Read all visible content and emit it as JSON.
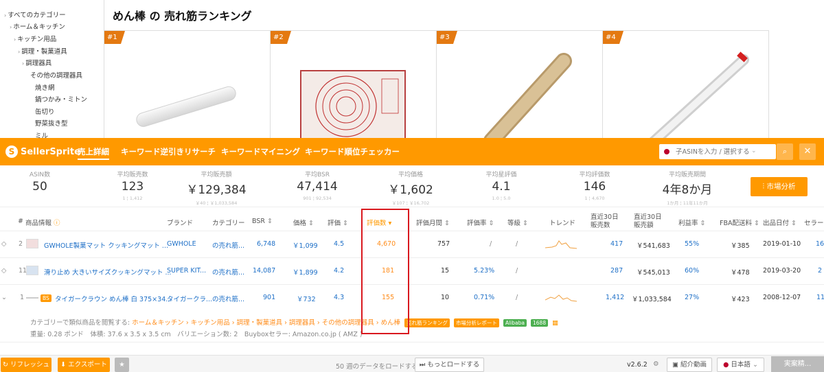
{
  "categories": [
    "すべてのカテゴリー",
    "ホーム＆キッチン",
    "キッチン用品",
    "調理・製菓道具",
    "調理器具",
    "その他の調理器具",
    "焼き網",
    "鍋つかみ・ミトン",
    "缶切り",
    "野菜抜き型",
    "ミル"
  ],
  "page_title": "めん棒 の 売れ筋ランキング",
  "ranks": [
    "#1",
    "#2",
    "#3",
    "#4"
  ],
  "brand": "SellerSprite",
  "nav": [
    "売上詳細",
    "キーワード逆引きリサーチ",
    "キーワードマイニング",
    "キーワード順位チェッカー"
  ],
  "search_placeholder": "子ASINを入力 / 選択する",
  "stats": [
    {
      "label": "ASIN数",
      "value": "50",
      "range": ""
    },
    {
      "label": "平均販売数",
      "value": "123",
      "range": "1 ¦ 1,412"
    },
    {
      "label": "平均販売額",
      "value": "￥129,384",
      "range": "￥40 ¦ ￥1,033,584"
    },
    {
      "label": "平均BSR",
      "value": "47,414",
      "range": "901 ¦ 92,534"
    },
    {
      "label": "平均価格",
      "value": "￥1,602",
      "range": "￥107 ¦ ￥16,702"
    },
    {
      "label": "平均星評価",
      "value": "4.1",
      "range": "1.0 ¦ 5.0"
    },
    {
      "label": "平均評価数",
      "value": "146",
      "range": "1 ¦ 4,670"
    },
    {
      "label": "平均販売期間",
      "value": "4年8か月",
      "range": "1か月 ¦ 11年11か月"
    }
  ],
  "market_btn": "市場分析",
  "headers": [
    "#",
    "商品情報",
    "ブランド",
    "カテゴリー",
    "BSR",
    "価格",
    "評価",
    "評価数",
    "評価月間",
    "評価率",
    "等級",
    "トレンド",
    "直近30日",
    "販売数",
    "直近30日",
    "販売額",
    "利益率",
    "FBA配送料",
    "出品日付",
    "セラー"
  ],
  "rows": [
    {
      "idx": "2",
      "title": "GWHOLE製菓マット クッキングマット ...",
      "brand": "GWHOLE",
      "cat": "の売れ筋...",
      "bsr": "6,748",
      "price": "￥1,099",
      "rating": "4.5",
      "reviews": "4,670",
      "monthly": "757",
      "rate": "/",
      "grade": "/",
      "sales": "417",
      "revenue": "￥541,683",
      "margin": "55%",
      "fba": "￥385",
      "date": "2019-01-10",
      "seller": "16"
    },
    {
      "idx": "11",
      "title": "滑り止め 大きいサイズクッキングマット ...",
      "brand": "SUPER KIT...",
      "cat": "の売れ筋...",
      "bsr": "14,087",
      "price": "￥1,899",
      "rating": "4.2",
      "reviews": "181",
      "monthly": "15",
      "rate": "5.23%",
      "grade": "/",
      "sales": "287",
      "revenue": "￥545,013",
      "margin": "60%",
      "fba": "￥478",
      "date": "2019-03-20",
      "seller": "2"
    },
    {
      "idx": "1",
      "title": "タイガークラウン めん棒 白 375×34...",
      "brand": "タイガークラ...",
      "cat": "の売れ筋...",
      "bsr": "901",
      "price": "￥732",
      "rating": "4.3",
      "reviews": "155",
      "monthly": "10",
      "rate": "0.71%",
      "grade": "/",
      "sales": "1,412",
      "revenue": "￥1,033,584",
      "margin": "27%",
      "fba": "￥423",
      "date": "2008-12-07",
      "seller": "11"
    }
  ],
  "badge_bs": "BS",
  "similar_label": "カテゴリーで類似商品を閲覧する:",
  "breadcrumb": "ホーム＆キッチン › キッチン用品 › 調理・製菓道具 › 調理器具 › その他の調理器具 › めん棒",
  "tags": [
    "売れ筋ランキング",
    "市場分析レポート",
    "Alibaba",
    "1688"
  ],
  "product_meta": "重量: 0.28 ポンド　体積: 37.6 x 3.5 x 3.5 cm　バリエーション数: 2　Buyboxセラー: Amazon.co.jp ( AMZ )",
  "refresh_btn": "リフレッシュ",
  "export_btn": "エクスポート",
  "load_text": "50 週のデータをロードする",
  "load_more_btn": "もっとロードする",
  "version": "v2.6.2",
  "intro_btn": "紹介動画",
  "lang": "日本語",
  "action_btn": "実案精..."
}
